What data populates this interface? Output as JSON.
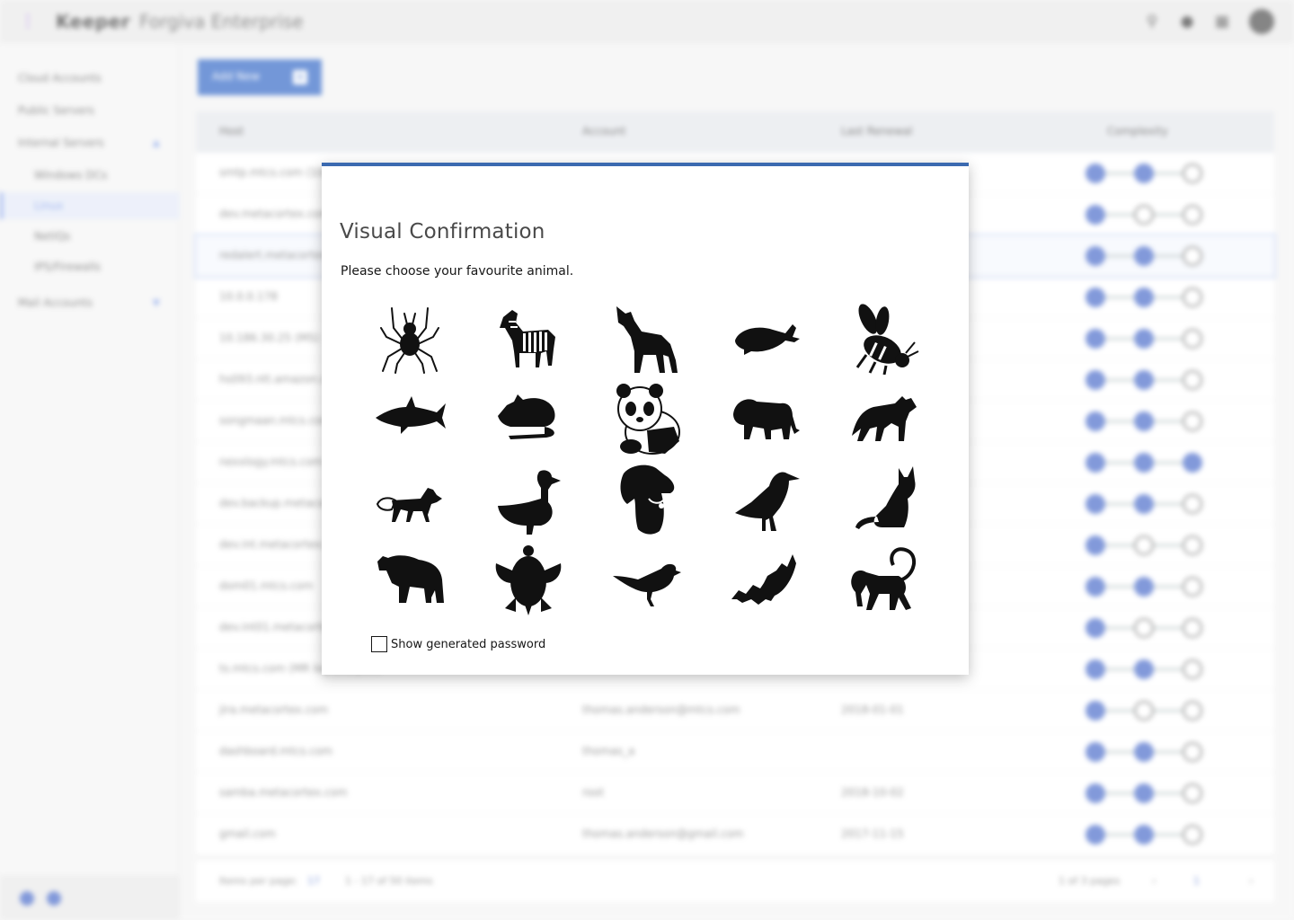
{
  "header": {
    "brand_mark": "Keeper",
    "product": "Forgiva Enterprise"
  },
  "sidebar": {
    "items": [
      {
        "label": "Cloud Accounts"
      },
      {
        "label": "Public Servers"
      },
      {
        "label": "Internal Servers"
      },
      {
        "label": "Windows DCs"
      },
      {
        "label": "Linux"
      },
      {
        "label": "NetIQs"
      },
      {
        "label": "IPS/Firewalls"
      },
      {
        "label": "Mail Accounts"
      }
    ]
  },
  "main": {
    "add_button_label": "Add New",
    "table": {
      "columns": [
        "Host",
        "Account",
        "Last Renewal",
        "Complexity"
      ],
      "rows": [
        {
          "host": "smtp.mtcs.com (100.1.2.4)",
          "account": "",
          "date": "",
          "level": 2
        },
        {
          "host": "dev.metacortex.com",
          "account": "",
          "date": "",
          "level": 1
        },
        {
          "host": "redalert.metacortex.com",
          "account": "",
          "date": "",
          "level": 2
        },
        {
          "host": "10.0.0.178",
          "account": "",
          "date": "",
          "level": 2
        },
        {
          "host": "10.186.30.25 (MS)",
          "account": "",
          "date": "",
          "level": 2
        },
        {
          "host": "hs093.ntt.amazon.com",
          "account": "",
          "date": "",
          "level": 2
        },
        {
          "host": "songmaan.mtcs.com",
          "account": "",
          "date": "",
          "level": 2
        },
        {
          "host": "nexxlogy.mtcs.com",
          "account": "",
          "date": "",
          "level": 3
        },
        {
          "host": "dev.backup.metacortex.com",
          "account": "",
          "date": "",
          "level": 2
        },
        {
          "host": "dev.int.metacortex.com",
          "account": "",
          "date": "",
          "level": 1
        },
        {
          "host": "dom01.mtcs.com",
          "account": "",
          "date": "",
          "level": 2
        },
        {
          "host": "dev.int01.metacortex.com",
          "account": "",
          "date": "",
          "level": 1
        },
        {
          "host": "ts.mtcs.com (MR log analysis)",
          "account": "",
          "date": "",
          "level": 2
        },
        {
          "host": "jira.metacortex.com",
          "account": "thomas.anderson@mtcs.com",
          "date": "2018-01-01",
          "level": 1
        },
        {
          "host": "dashboard.mtcs.com",
          "account": "thomas_a",
          "date": "",
          "level": 2
        },
        {
          "host": "samba.metacortex.com",
          "account": "root",
          "date": "2018-10-02",
          "level": 2
        },
        {
          "host": "gmail.com",
          "account": "thomas.anderson@gmail.com",
          "date": "2017-11-15",
          "level": 2
        }
      ]
    },
    "pager": {
      "items_per_page_label": "Items per page:",
      "items_per_page_value": "17",
      "range": "1 - 17 of 50 items",
      "pages": "1 of 3 pages",
      "page_value": "1"
    }
  },
  "modal": {
    "title": "Visual Confirmation",
    "subtitle": "Please choose your favourite animal.",
    "animals": [
      "spider",
      "zebra",
      "wolf",
      "whale",
      "bee",
      "shark",
      "mouse",
      "panda",
      "lion",
      "hyena",
      "fox",
      "duck",
      "dog",
      "crow",
      "cat",
      "bear",
      "turtle",
      "bird",
      "bat",
      "monkey"
    ],
    "show_password_label": "Show generated password",
    "show_password_checked": false
  },
  "colors": {
    "accent": "#3b6ab0",
    "primary_button": "#2860c4",
    "complexity_on": "#3f63c7"
  }
}
